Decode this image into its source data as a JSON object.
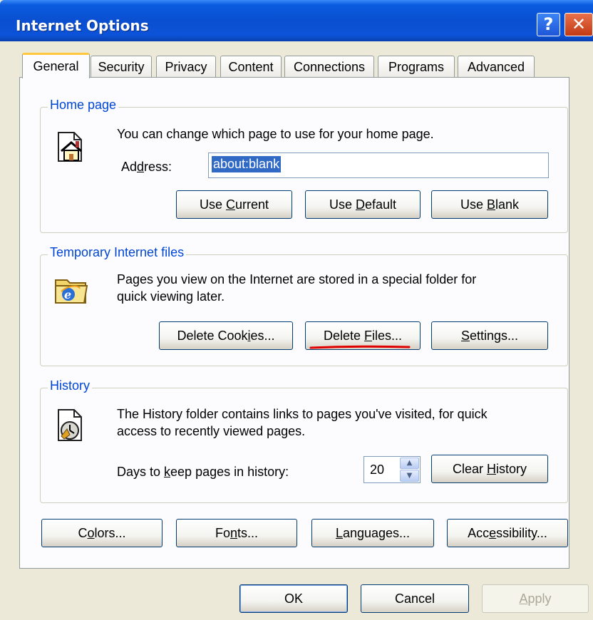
{
  "window": {
    "title": "Internet Options"
  },
  "tabs": [
    {
      "label": "General"
    },
    {
      "label": "Security"
    },
    {
      "label": "Privacy"
    },
    {
      "label": "Content"
    },
    {
      "label": "Connections"
    },
    {
      "label": "Programs"
    },
    {
      "label": "Advanced"
    }
  ],
  "home_page": {
    "legend": "Home page",
    "description": "You can change which page to use for your home page.",
    "address_label_pre": "Ad",
    "address_label_u": "d",
    "address_label_post": "ress:",
    "address_value": "about:blank",
    "buttons": {
      "use_current": {
        "pre": "Use ",
        "u": "C",
        "post": "urrent"
      },
      "use_default": {
        "pre": "Use ",
        "u": "D",
        "post": "efault"
      },
      "use_blank": {
        "pre": "Use ",
        "u": "B",
        "post": "lank"
      }
    }
  },
  "temp_files": {
    "legend": "Temporary Internet files",
    "description_line1": "Pages you view on the Internet are stored in a special folder for",
    "description_line2": "quick viewing later.",
    "buttons": {
      "delete_cookies": {
        "pre": "Delete Cook",
        "u": "i",
        "post": "es..."
      },
      "delete_files": {
        "pre": "Delete ",
        "u": "F",
        "post": "iles..."
      },
      "settings": {
        "pre": "",
        "u": "S",
        "post": "ettings..."
      }
    }
  },
  "history": {
    "legend": "History",
    "description_line1": "The History folder contains links to pages you've visited, for quick",
    "description_line2": "access to recently viewed pages.",
    "days_label_pre": "Days to ",
    "days_label_u": "k",
    "days_label_post": "eep pages in history:",
    "days_value": "20",
    "clear_button": {
      "pre": "Clear ",
      "u": "H",
      "post": "istory"
    }
  },
  "bottom_buttons": {
    "colors": {
      "pre": "C",
      "u": "o",
      "post": "lors..."
    },
    "fonts": {
      "pre": "Fo",
      "u": "n",
      "post": "ts..."
    },
    "languages": {
      "pre": "",
      "u": "L",
      "post": "anguages..."
    },
    "accessibility": {
      "pre": "Acc",
      "u": "e",
      "post": "ssibility..."
    }
  },
  "dialog_buttons": {
    "ok": "OK",
    "cancel": "Cancel",
    "apply": {
      "u": "A",
      "post": "pply"
    }
  },
  "colors": {
    "title_bar": "#0A4FD0",
    "legend_text": "#0046D5",
    "selection": "#316AC5",
    "annotation": "#E00000"
  }
}
